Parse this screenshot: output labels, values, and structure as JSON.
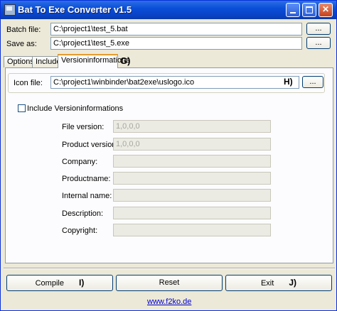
{
  "window": {
    "title": "Bat To Exe Converter v1.5",
    "colors": {
      "titlebar": "#0a4fd8",
      "close": "#c6411e",
      "active_tab_accent": "#e69b2e"
    }
  },
  "batch_file": {
    "label": "Batch file:",
    "value": "C:\\project1\\test_5.bat",
    "browse_label": "..."
  },
  "save_as": {
    "label": "Save as:",
    "value": "C:\\project1\\test_5.exe",
    "browse_label": "..."
  },
  "tabs": [
    {
      "label": "Options"
    },
    {
      "label": "Include"
    },
    {
      "label": "Versioninformations",
      "active": true
    }
  ],
  "annotations": {
    "tab_marker": "G)",
    "icon_marker": "H)",
    "compile_marker": "I)",
    "exit_marker": "J)"
  },
  "icon_file": {
    "label": "Icon file:",
    "value": "C:\\project1\\winbinder\\bat2exe\\uslogo.ico",
    "browse_label": "..."
  },
  "include_versioninfo": {
    "label": "Include Versioninformations",
    "checked": false
  },
  "version_fields": [
    {
      "label": "File version:",
      "value": "1,0,0,0"
    },
    {
      "label": "Product version:",
      "value": "1,0,0,0"
    },
    {
      "label": "Company:",
      "value": ""
    },
    {
      "label": "Productname:",
      "value": ""
    },
    {
      "label": "Internal name:",
      "value": ""
    },
    {
      "label": "Description:",
      "value": ""
    },
    {
      "label": "Copyright:",
      "value": ""
    }
  ],
  "buttons": {
    "compile": "Compile",
    "reset": "Reset",
    "exit": "Exit"
  },
  "footer": {
    "link": "www.f2ko.de"
  }
}
